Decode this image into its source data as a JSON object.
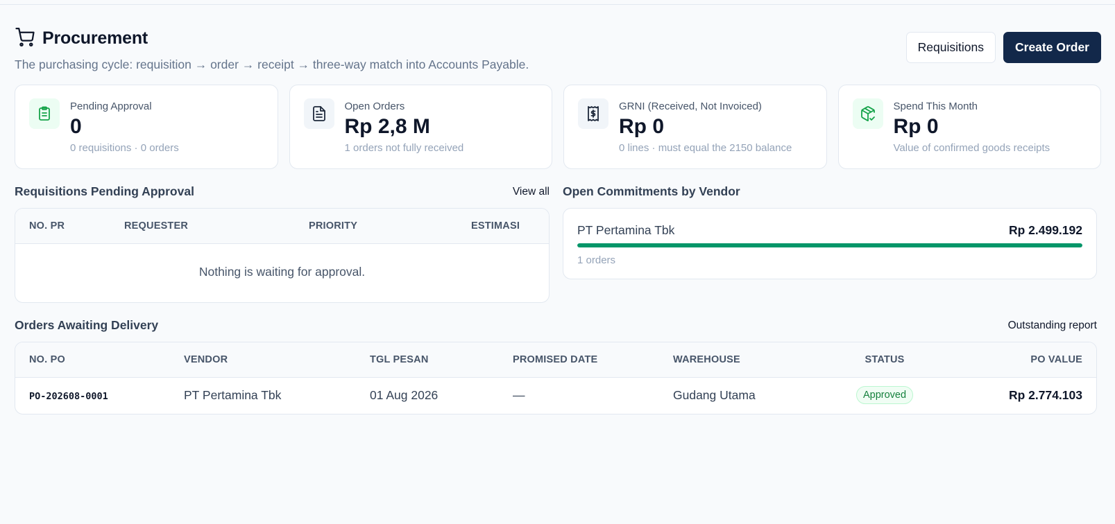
{
  "header": {
    "title": "Procurement",
    "subtitle": "The purchasing cycle: requisition → order → receipt → three-way match into Accounts Payable.",
    "requisitions_label": "Requisitions",
    "create_order_label": "Create Order"
  },
  "stats": [
    {
      "label": "Pending Approval",
      "value": "0",
      "sub": "0 requisitions · 0 orders",
      "icon": "clipboard-icon"
    },
    {
      "label": "Open Orders",
      "value": "Rp 2,8 M",
      "sub": "1 orders not fully received",
      "icon": "document-icon"
    },
    {
      "label": "GRNI (Received, Not Invoiced)",
      "value": "Rp 0",
      "sub": "0 lines · must equal the 2150 balance",
      "icon": "receipt-icon"
    },
    {
      "label": "Spend This Month",
      "value": "Rp 0",
      "sub": "Value of confirmed goods receipts",
      "icon": "package-check-icon"
    }
  ],
  "requisitions": {
    "title": "Requisitions Pending Approval",
    "link": "View all",
    "columns": [
      "No. PR",
      "Requester",
      "Priority",
      "Estimasi"
    ],
    "empty": "Nothing is waiting for approval."
  },
  "commitments": {
    "title": "Open Commitments by Vendor",
    "vendors": [
      {
        "name": "PT Pertamina Tbk",
        "amount": "Rp 2.499.192",
        "sub": "1 orders",
        "share": 1.0
      }
    ],
    "bar_color": "#059669"
  },
  "orders": {
    "title": "Orders Awaiting Delivery",
    "link": "Outstanding report",
    "columns": [
      "No. PO",
      "Vendor",
      "Tgl Pesan",
      "Promised Date",
      "Warehouse",
      "Status",
      "PO Value"
    ],
    "rows": [
      {
        "po": "PO-202608-0001",
        "vendor": "PT Pertamina Tbk",
        "date": "01 Aug 2026",
        "promised": "—",
        "warehouse": "Gudang Utama",
        "status": "Approved",
        "value": "Rp 2.774.103"
      }
    ]
  },
  "colors": {
    "primary": "#12284a",
    "success": "#15803d",
    "accent": "#059669"
  }
}
